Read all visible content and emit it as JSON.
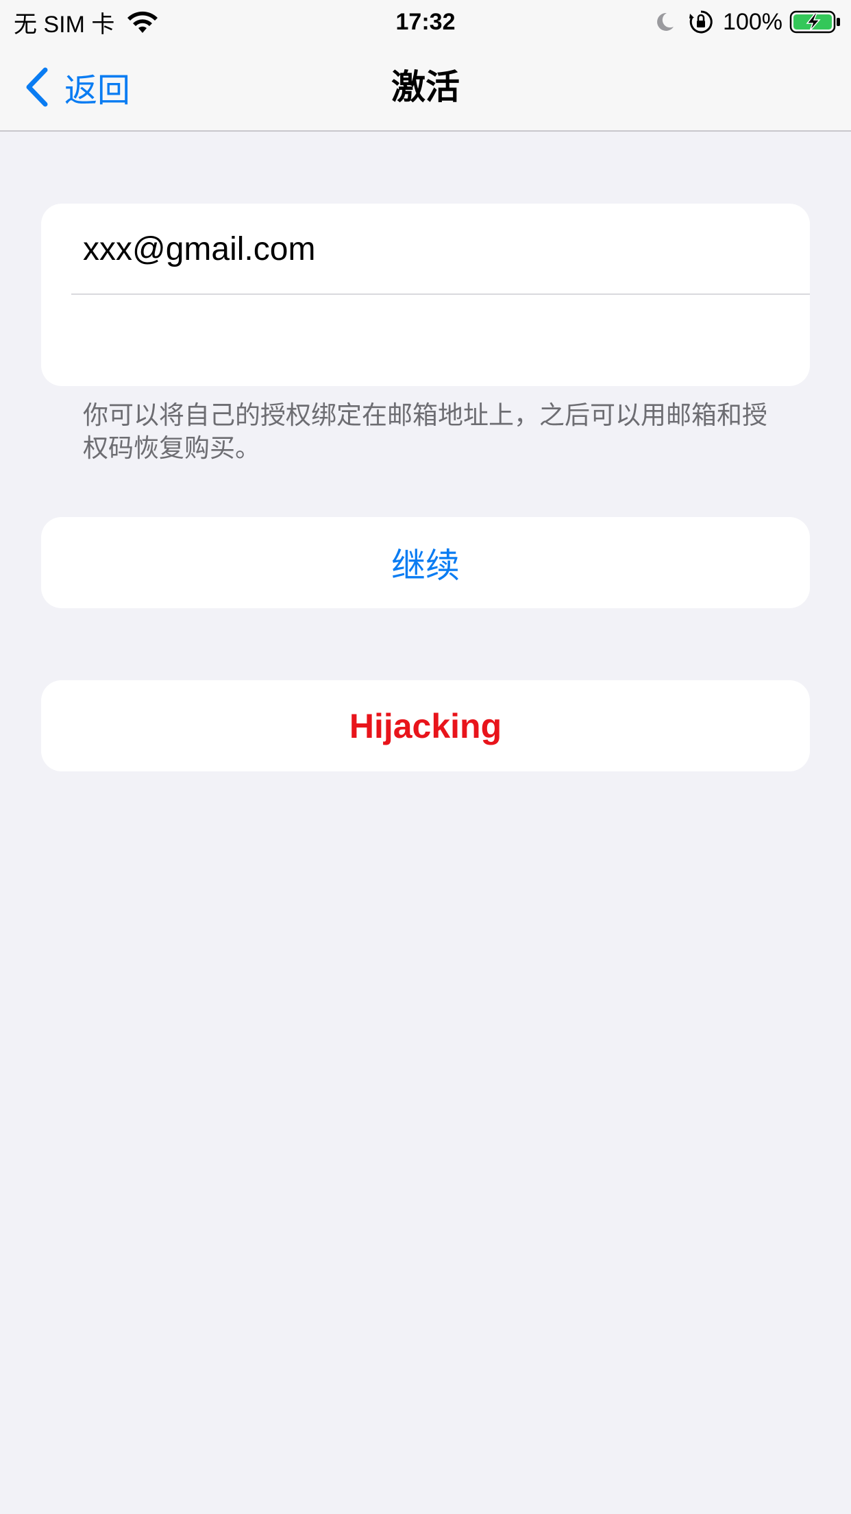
{
  "status_bar": {
    "carrier": "无 SIM 卡",
    "time": "17:32",
    "battery": "100%",
    "icons": [
      "wifi-icon",
      "moon-icon",
      "orientation-lock-icon",
      "battery-charging-icon"
    ],
    "battery_color": "#34c759"
  },
  "nav": {
    "back_label": "返回",
    "title": "激活"
  },
  "form": {
    "email_value": "xxx@gmail.com",
    "code_value": "",
    "hint": "你可以将自己的授权绑定在邮箱地址上，之后可以用邮箱和授权码恢复购买。"
  },
  "buttons": {
    "continue_label": "继续",
    "hijacking_label": "Hijacking"
  },
  "colors": {
    "accent": "#0a7cf2",
    "danger": "#e8141b",
    "background": "#f2f2f7"
  }
}
